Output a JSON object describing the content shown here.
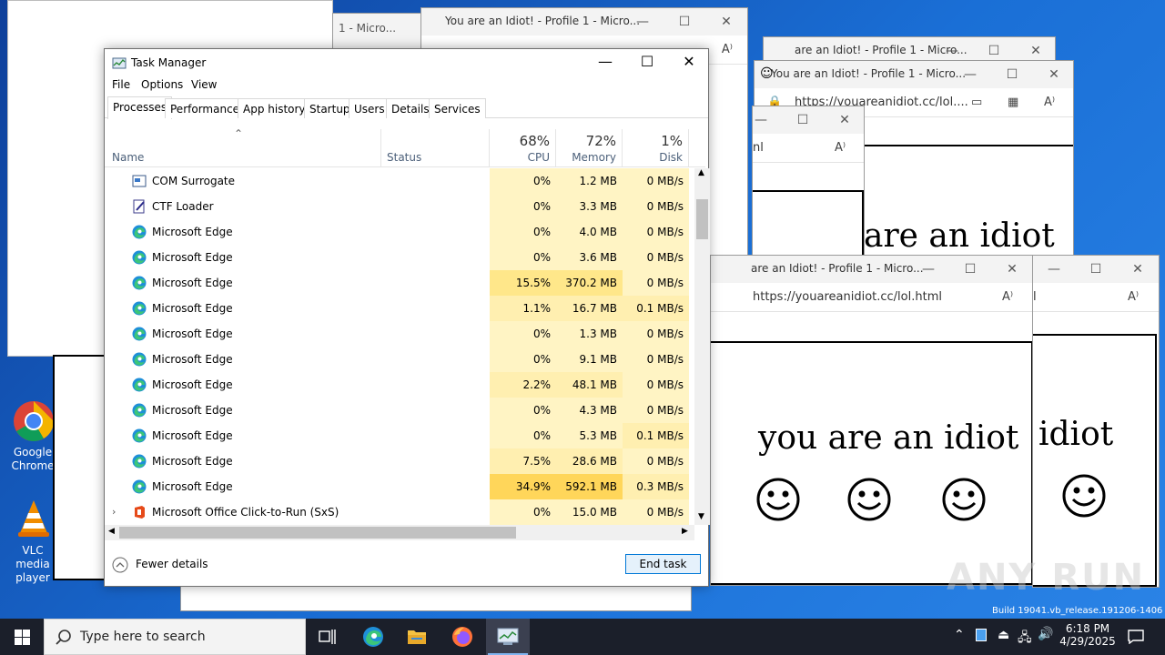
{
  "desktop": {
    "icons": [
      {
        "label_lines": [
          "Google",
          "Chrome"
        ],
        "icon": "chrome-icon"
      },
      {
        "label_lines": [
          "VLC media",
          "player"
        ],
        "icon": "vlc-icon"
      }
    ],
    "watermark": "ANY RUN",
    "build_text": "Build 19041.vb_release.191206-1406"
  },
  "browser_windows": {
    "title": "You are an Idiot! - Profile 1 - Micro...",
    "title_partial": "are an Idiot! - Profile 1 - Micro...",
    "title_stub": "1 - Micro...",
    "url": "https://youareanidiot.cc/lol.html",
    "url_short": "https://youareanidiot.cc/lol....",
    "url_tail": "nl",
    "url_tail2": "l",
    "page_text": "you are an idiot",
    "page_text_partial": "are an idiot",
    "page_text_tail": "idiot"
  },
  "task_manager": {
    "title": "Task Manager",
    "menu": [
      "File",
      "Options",
      "View"
    ],
    "tabs": [
      "Processes",
      "Performance",
      "App history",
      "Startup",
      "Users",
      "Details",
      "Services"
    ],
    "active_tab": "Processes",
    "columns": {
      "name": "Name",
      "status": "Status",
      "cpu": {
        "pct": "68%",
        "label": "CPU"
      },
      "memory": {
        "pct": "72%",
        "label": "Memory"
      },
      "disk": {
        "pct": "1%",
        "label": "Disk"
      }
    },
    "rows": [
      {
        "name": "COM Surrogate",
        "icon": "com-surrogate-icon",
        "cpu": "0%",
        "memory": "1.2 MB",
        "disk": "0 MB/s",
        "heat": 0
      },
      {
        "name": "CTF Loader",
        "icon": "ctf-loader-icon",
        "cpu": "0%",
        "memory": "3.3 MB",
        "disk": "0 MB/s",
        "heat": 0
      },
      {
        "name": "Microsoft Edge",
        "icon": "edge-icon",
        "cpu": "0%",
        "memory": "4.0 MB",
        "disk": "0 MB/s",
        "heat": 0
      },
      {
        "name": "Microsoft Edge",
        "icon": "edge-icon",
        "cpu": "0%",
        "memory": "3.6 MB",
        "disk": "0 MB/s",
        "heat": 0
      },
      {
        "name": "Microsoft Edge",
        "icon": "edge-icon",
        "cpu": "15.5%",
        "memory": "370.2 MB",
        "disk": "0 MB/s",
        "heat": 2
      },
      {
        "name": "Microsoft Edge",
        "icon": "edge-icon",
        "cpu": "1.1%",
        "memory": "16.7 MB",
        "disk": "0.1 MB/s",
        "heat": 1
      },
      {
        "name": "Microsoft Edge",
        "icon": "edge-icon",
        "cpu": "0%",
        "memory": "1.3 MB",
        "disk": "0 MB/s",
        "heat": 0
      },
      {
        "name": "Microsoft Edge",
        "icon": "edge-icon",
        "cpu": "0%",
        "memory": "9.1 MB",
        "disk": "0 MB/s",
        "heat": 0
      },
      {
        "name": "Microsoft Edge",
        "icon": "edge-icon",
        "cpu": "2.2%",
        "memory": "48.1 MB",
        "disk": "0 MB/s",
        "heat": 1
      },
      {
        "name": "Microsoft Edge",
        "icon": "edge-icon",
        "cpu": "0%",
        "memory": "4.3 MB",
        "disk": "0 MB/s",
        "heat": 0
      },
      {
        "name": "Microsoft Edge",
        "icon": "edge-icon",
        "cpu": "0%",
        "memory": "5.3 MB",
        "disk": "0.1 MB/s",
        "heat": 0
      },
      {
        "name": "Microsoft Edge",
        "icon": "edge-icon",
        "cpu": "7.5%",
        "memory": "28.6 MB",
        "disk": "0 MB/s",
        "heat": 1
      },
      {
        "name": "Microsoft Edge",
        "icon": "edge-icon",
        "cpu": "34.9%",
        "memory": "592.1 MB",
        "disk": "0.3 MB/s",
        "heat": 3
      },
      {
        "name": "Microsoft Office Click-to-Run (SxS)",
        "icon": "office-icon",
        "cpu": "0%",
        "memory": "15.0 MB",
        "disk": "0 MB/s",
        "heat": 0
      }
    ],
    "fewer_details": "Fewer details",
    "end_task": "End task"
  },
  "taskbar": {
    "search_placeholder": "Type here to search",
    "time": "6:18 PM",
    "date": "4/29/2025"
  },
  "colors": {
    "heat0": "#fff4c4",
    "heat1": "#ffefb0",
    "heat2": "#ffe78a",
    "heat3": "#ffd65a",
    "accent": "#0078d7"
  }
}
